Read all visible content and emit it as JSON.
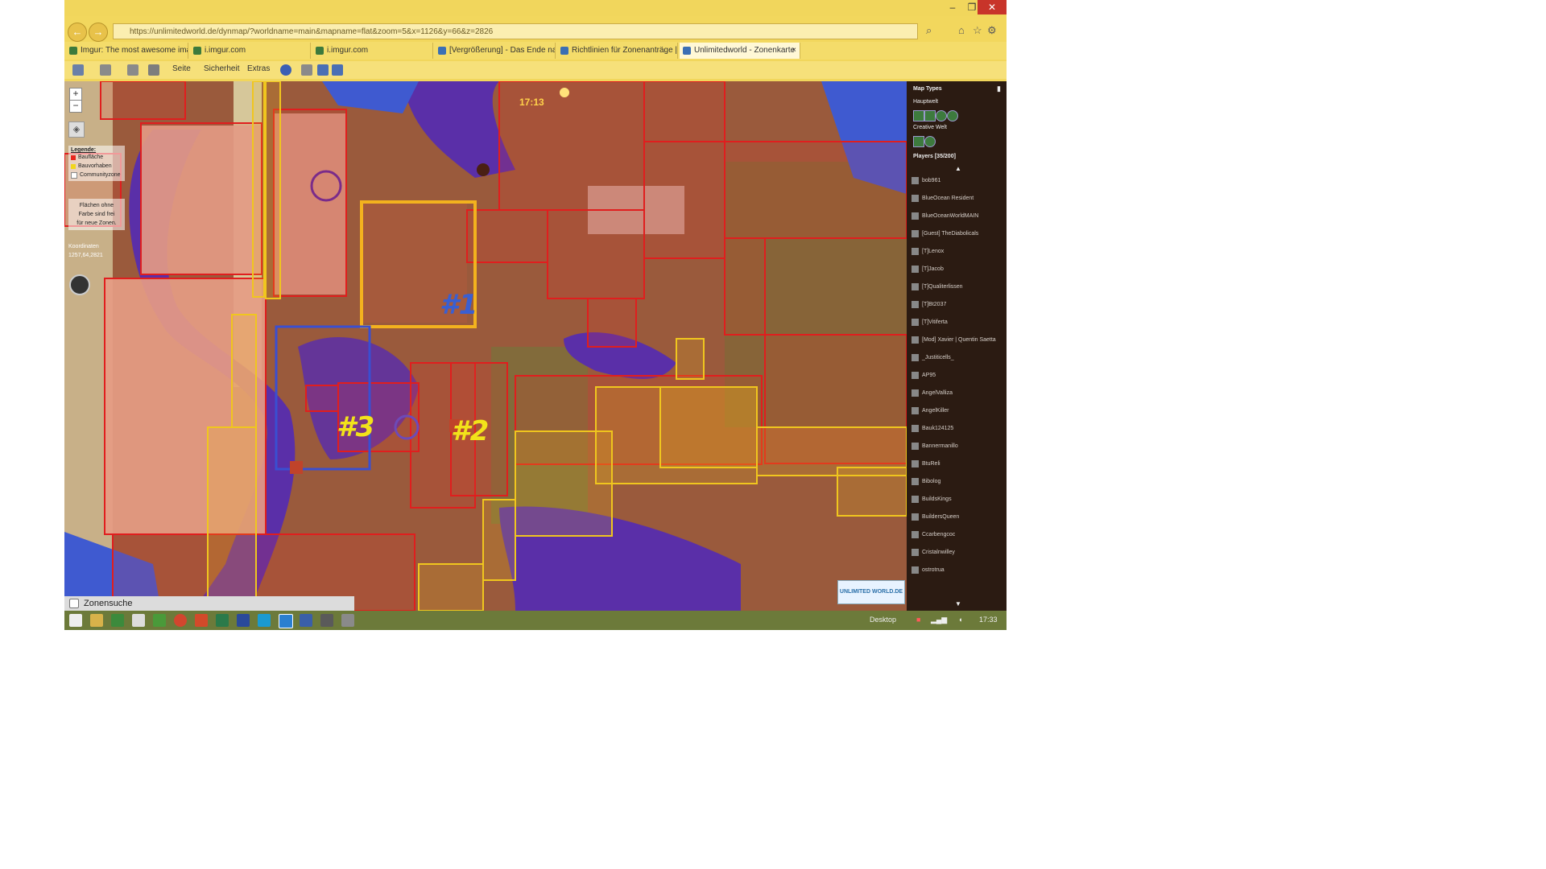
{
  "browser": {
    "url": "https://unlimitedworld.de/dynmap/?worldname=main&mapname=flat&zoom=5&x=1126&y=66&z=2826",
    "tabs": [
      {
        "label": "Imgur: The most awesome ima..."
      },
      {
        "label": "i.imgur.com"
      },
      {
        "label": "i.imgur.com"
      },
      {
        "label": "[Vergrößerung] - Das Ende nah..."
      },
      {
        "label": "Richtlinien für Zonenanträge |..."
      },
      {
        "label": "Unlimitedworld - Zonenkarte"
      }
    ],
    "close_tab": "×",
    "commands": {
      "page": "Seite",
      "security": "Sicherheit",
      "extras": "Extras"
    }
  },
  "map": {
    "clock": "17:13",
    "legend": {
      "title": "Legende:",
      "items": [
        {
          "label": "Baufläche",
          "color": "#e8261e"
        },
        {
          "label": "Bauvorhaben",
          "color": "#f1d61e"
        },
        {
          "label": "Communityzone",
          "color": "#ffffff"
        }
      ]
    },
    "note": [
      "Flächen ohne",
      "Farbe sind frei",
      "für neue Zonen."
    ],
    "coords_label": "Koordinaten",
    "coords_value": "1257,64,2821",
    "markers": [
      {
        "text": "#1",
        "color": "#3a5fd1"
      },
      {
        "text": "#2",
        "color": "#f2e21a"
      },
      {
        "text": "#3",
        "color": "#f2e21a"
      }
    ],
    "search_label": "Zonensuche",
    "logo_text": "UNLIMITED WORLD.DE"
  },
  "panel": {
    "map_types_title": "Map Types",
    "world1": "Hauptwelt",
    "world2": "Creative Welt",
    "players_title": "Players [35/200]",
    "players": [
      "bob961",
      "BlueOcean Resident",
      "BlueOceanWorldMAIN",
      "[Guest] TheDiabolicals",
      "[T]Lenox",
      "[T]Jacob",
      "[T]Qualiterlissen",
      "[T]Bt2037",
      "[T]Vitiferta",
      "[Mod] Xavier | Quentin Saetta",
      "_Justiticells_",
      "AP95",
      "AngelValliza",
      "AngelKiller",
      "Bauk124125",
      "Bannermanillo",
      "BtuReli",
      "Bibolog",
      "BuildsKings",
      "BuildersQueen",
      "Ccarbengcoc",
      "Cristalnwilley",
      "ostrotrua"
    ]
  },
  "taskbar": {
    "desktop": "Desktop",
    "time": "17:33"
  }
}
